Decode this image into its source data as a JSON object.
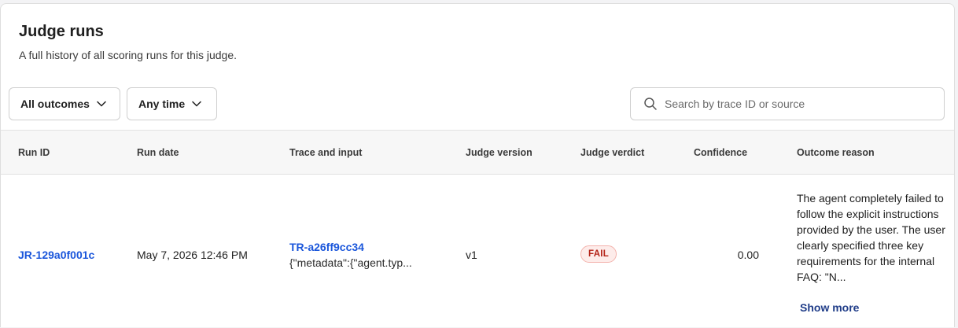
{
  "header": {
    "title": "Judge runs",
    "subtitle": "A full history of all scoring runs for this judge."
  },
  "filters": {
    "outcomes_label": "All outcomes",
    "time_label": "Any time"
  },
  "search": {
    "placeholder": "Search by trace ID or source",
    "value": ""
  },
  "table": {
    "columns": {
      "run_id": "Run ID",
      "run_date": "Run date",
      "trace_input": "Trace and input",
      "judge_version": "Judge version",
      "judge_verdict": "Judge verdict",
      "confidence": "Confidence",
      "outcome_reason": "Outcome reason"
    },
    "rows": [
      {
        "run_id": "JR-129a0f001c",
        "run_date": "May 7, 2026 12:46 PM",
        "trace_id": "TR-a26ff9cc34",
        "trace_input": "{\"metadata\":{\"agent.typ...",
        "judge_version": "v1",
        "verdict": "FAIL",
        "confidence": "0.00",
        "reason": "The agent completely failed to follow the explicit instructions provided by the user. The user clearly specified three key requirements for the internal FAQ: \"N...",
        "show_more": "Show more"
      }
    ]
  },
  "colors": {
    "link": "#1a56db",
    "fail_text": "#b42318",
    "fail_bg": "#fdecea",
    "header_bg": "#f7f7f7"
  },
  "icons": {
    "search": "search-icon",
    "dropdown": "chevron-down-icon"
  }
}
